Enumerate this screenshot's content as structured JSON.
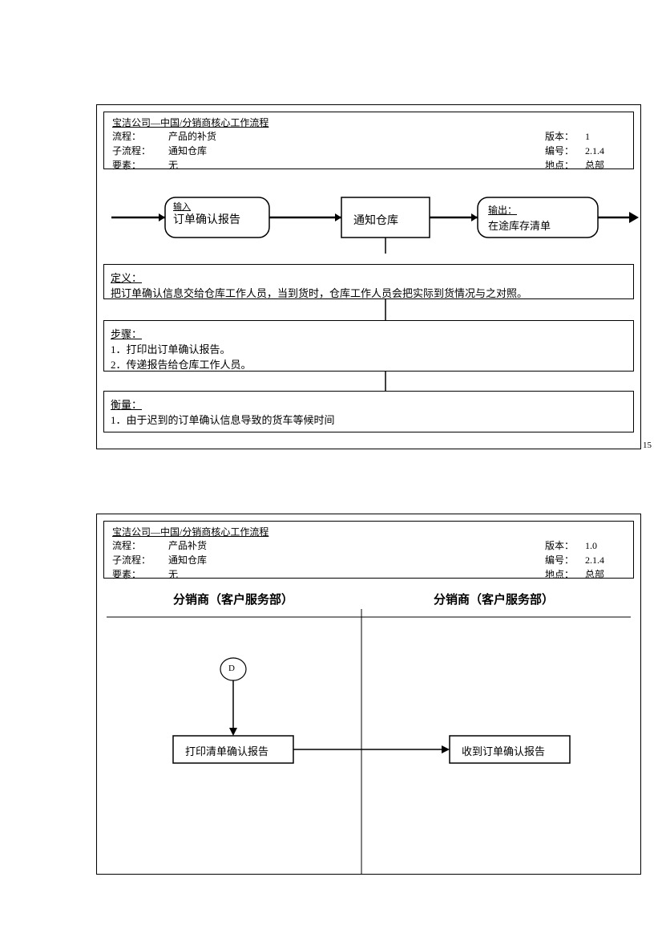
{
  "panel1": {
    "header": {
      "title": "宝洁公司—中国/分销商核心工作流程",
      "rows": [
        {
          "l": "流程：",
          "m": "产品的补货",
          "rl": "版本：",
          "rv": "1"
        },
        {
          "l": "子流程：",
          "m": "通知仓库",
          "rl": "编号：",
          "rv": "2.1.4"
        },
        {
          "l": "要素：",
          "m": "无",
          "rl": "地点：",
          "rv": "总部"
        }
      ]
    },
    "flow": {
      "input_label": "输入",
      "input_text": "订单确认报告",
      "center_text": "通知仓库",
      "output_label": "输出：",
      "output_text": "在途库存清单"
    },
    "definition": {
      "label": "定义：",
      "text": "把订单确认信息交给仓库工作人员，当到货时，仓库工作人员会把实际到货情况与之对照。"
    },
    "steps": {
      "label": "步骤：",
      "items": [
        "1．打印出订单确认报告。",
        "2．传递报告给仓库工作人员。"
      ]
    },
    "measure": {
      "label": "衡量：",
      "items": [
        "1．由于迟到的订单确认信息导致的货车等候时间"
      ]
    },
    "page_num": "15"
  },
  "panel2": {
    "header": {
      "title": "宝洁公司—中国/分销商核心工作流程",
      "rows": [
        {
          "l": "流程：",
          "m": "产品补货",
          "rl": "版本：",
          "rv": "1.0"
        },
        {
          "l": "子流程：",
          "m": "通知仓库",
          "rl": "编号：",
          "rv": "2.1.4"
        },
        {
          "l": "要素：",
          "m": "无",
          "rl": "地点：",
          "rv": "总部"
        }
      ]
    },
    "col_left": "分销商（客户服务部）",
    "col_right": "分销商（客户服务部）",
    "node_d": "D",
    "box_left": "打印清单确认报告",
    "box_right": "收到订单确认报告"
  }
}
